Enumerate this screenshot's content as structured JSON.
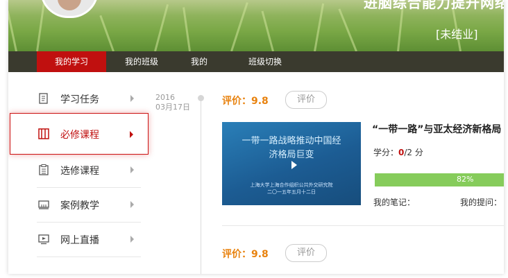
{
  "header": {
    "title": "进脑综合能力提升网络",
    "status": "[未结业]"
  },
  "nav": {
    "items": [
      {
        "label": "我的学习"
      },
      {
        "label": "我的班级"
      },
      {
        "label": "我的"
      },
      {
        "label": "班级切换"
      }
    ]
  },
  "sidebar": {
    "items": [
      {
        "label": "学习任务"
      },
      {
        "label": "必修课程"
      },
      {
        "label": "选修课程"
      },
      {
        "label": "案例教学"
      },
      {
        "label": "网上直播"
      }
    ]
  },
  "timeline": {
    "year": "2016",
    "date": "03月17日"
  },
  "courses": [
    {
      "rating_label": "评价：9.8",
      "eval_button": "评价",
      "thumb_title_line1": "一带一路战略推动中国经",
      "thumb_title_line2": "济格局巨变",
      "thumb_sub_line1": "上海大学上海合作组织公共外交研究院",
      "thumb_sub_line2": "二〇一五年五月十二日",
      "title": "“一带一路”与亚太经济新格局",
      "credit_label": "学分：",
      "credit_earned": "0",
      "credit_total": "/2 分",
      "progress_text": "82%",
      "progress": 0.82,
      "my_notes": "我的笔记：",
      "my_questions": "我的提问："
    },
    {
      "rating_label": "评价：9.8",
      "eval_button": "评价"
    }
  ],
  "colors": {
    "accent": "#c0100f",
    "rating": "#e8820e",
    "progress": "#86cc5b",
    "nav_bg": "#3a3a2e"
  }
}
